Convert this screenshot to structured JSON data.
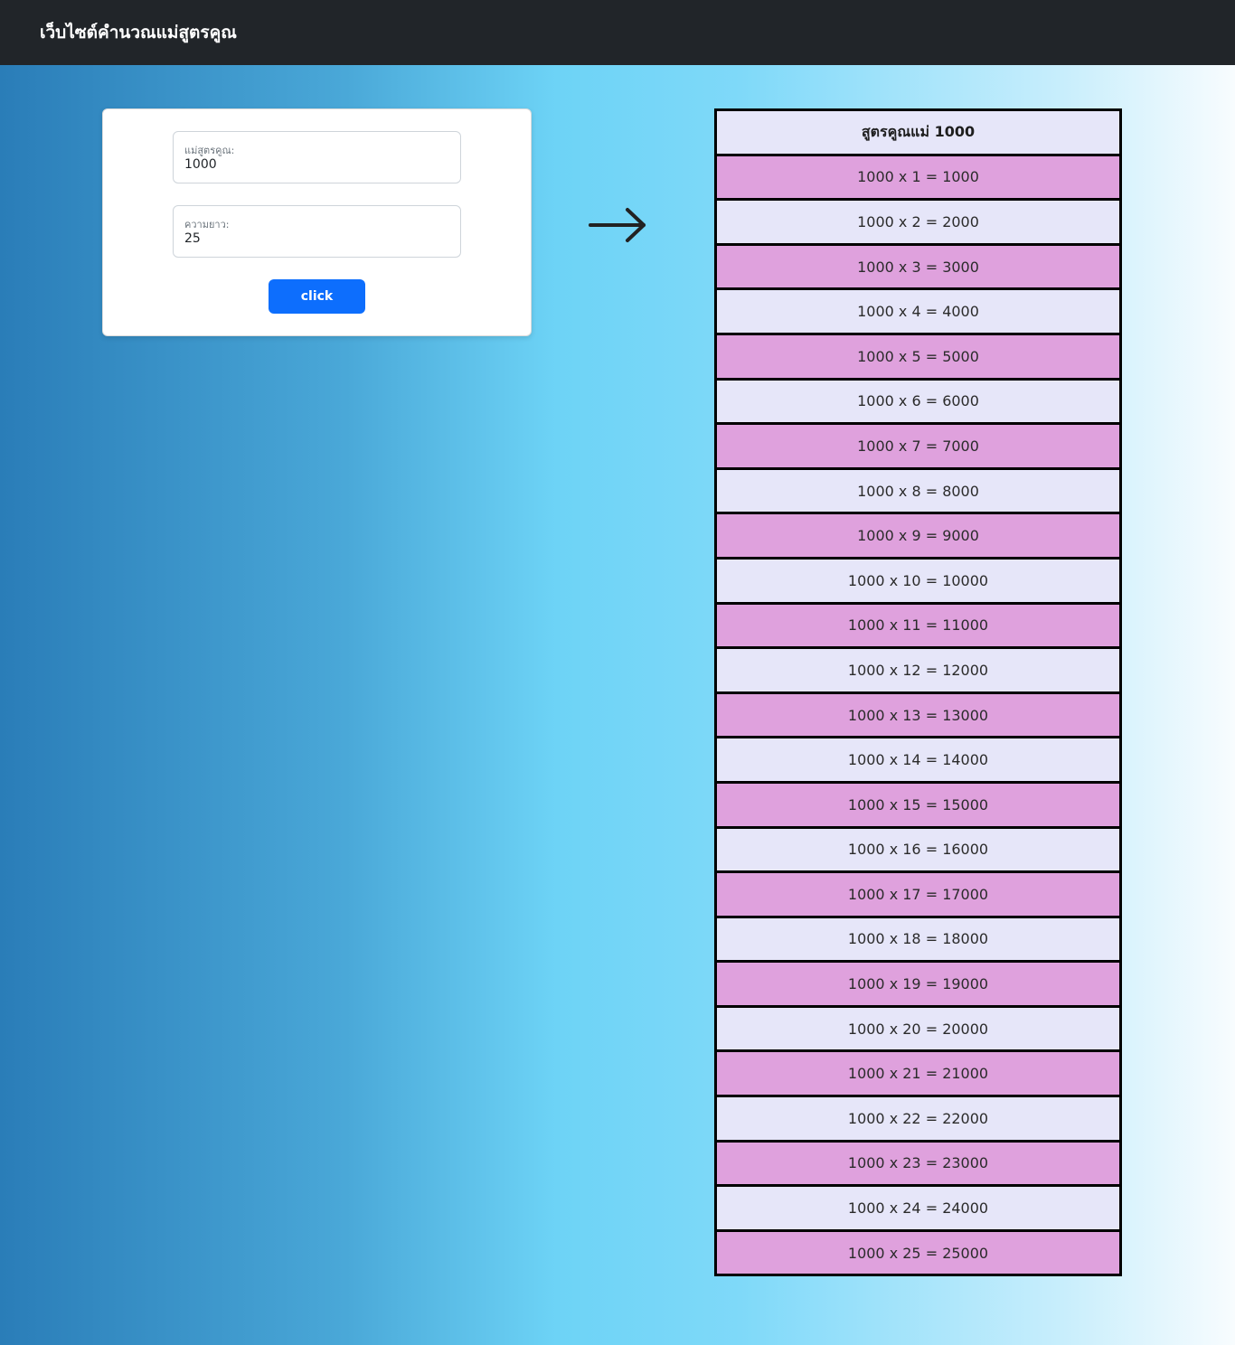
{
  "navbar": {
    "brand": "เว็บไซต์คำนวณแม่สูตรคูณ"
  },
  "form": {
    "base_label": "แม่สูตรคูณ:",
    "base_value": "1000",
    "length_label": "ความยาว:",
    "length_value": "25",
    "submit_label": "click"
  },
  "icons": {
    "arrow": "arrow-right-icon"
  },
  "table": {
    "header": "สูตรคูณแม่ 1000",
    "rows": [
      "1000 x 1 = 1000",
      "1000 x 2 = 2000",
      "1000 x 3 = 3000",
      "1000 x 4 = 4000",
      "1000 x 5 = 5000",
      "1000 x 6 = 6000",
      "1000 x 7 = 7000",
      "1000 x 8 = 8000",
      "1000 x 9 = 9000",
      "1000 x 10 = 10000",
      "1000 x 11 = 11000",
      "1000 x 12 = 12000",
      "1000 x 13 = 13000",
      "1000 x 14 = 14000",
      "1000 x 15 = 15000",
      "1000 x 16 = 16000",
      "1000 x 17 = 17000",
      "1000 x 18 = 18000",
      "1000 x 19 = 19000",
      "1000 x 20 = 20000",
      "1000 x 21 = 21000",
      "1000 x 22 = 22000",
      "1000 x 23 = 23000",
      "1000 x 24 = 24000",
      "1000 x 25 = 25000"
    ]
  },
  "colors": {
    "navbar_bg": "#212529",
    "button_bg": "#0d6efd",
    "row_odd": "#dfa1dd",
    "row_even": "#e6e6f9"
  }
}
